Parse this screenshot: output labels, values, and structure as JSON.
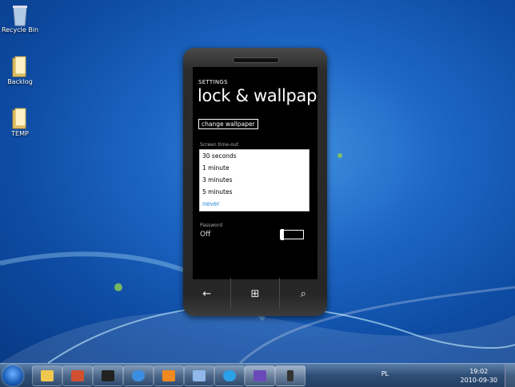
{
  "desktop": {
    "icons": [
      {
        "label": "Recycle Bin",
        "icon": "recycle-bin-icon"
      },
      {
        "label": "Backlog",
        "icon": "folder-icon"
      },
      {
        "label": "TEMP",
        "icon": "folder-icon"
      }
    ]
  },
  "phone": {
    "app_title": "SETTINGS",
    "page_title": "lock & wallpape",
    "change_wallpaper_label": "change wallpaper",
    "timeout_label": "Screen time-out",
    "timeout_options": [
      "30 seconds",
      "1 minute",
      "3 minutes",
      "5 minutes",
      "never"
    ],
    "timeout_selected": "never",
    "password_label": "Password",
    "password_value": "Off",
    "password_enabled": false,
    "hw_buttons": [
      {
        "icon": "back-arrow-icon",
        "glyph": "←"
      },
      {
        "icon": "windows-logo-icon",
        "glyph": "⊞"
      },
      {
        "icon": "search-icon",
        "glyph": "⌕"
      }
    ]
  },
  "taskbar": {
    "pinned": [
      "explorer-icon",
      "tools-icon",
      "media-center-icon",
      "internet-explorer-icon",
      "media-player-icon",
      "app-icon",
      "skype-icon",
      "visual-studio-icon",
      "phone-emulator-icon"
    ],
    "language": "PL",
    "time": "19:02",
    "date": "2010-09-30"
  },
  "colors": {
    "accent": "#2a8fde",
    "desktop": "#1d66c4"
  }
}
